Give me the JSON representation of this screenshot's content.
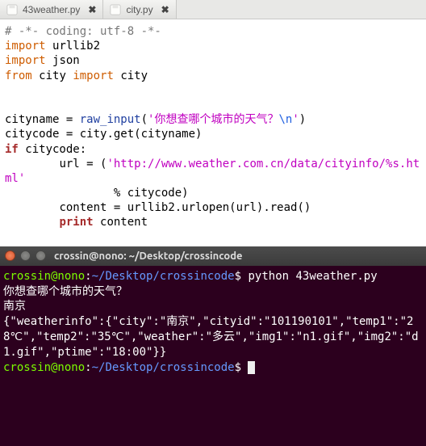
{
  "editor": {
    "tabs": [
      {
        "filename": "43weather.py",
        "close_glyph": "✖"
      },
      {
        "filename": "city.py",
        "close_glyph": "✖"
      }
    ],
    "code": {
      "l1": "# -*- coding: utf-8 -*-",
      "l2_kw": "import",
      "l2_mod": "urllib2",
      "l3_kw": "import",
      "l3_mod": "json",
      "l4_kw": "from",
      "l4_mod": "city",
      "l4_kw2": "import",
      "l4_name": "city",
      "l6_a": "cityname ",
      "l6_eq": "=",
      "l6_fn": " raw_input",
      "l6_paren_o": "(",
      "l6_str_o": "'",
      "l6_str_body": "你想查哪个城市的天气？",
      "l6_esc": "\\n",
      "l6_str_c": "'",
      "l6_paren_c": ")",
      "l7_a": "citycode ",
      "l7_eq": "=",
      "l7_rest": " city.get(cityname)",
      "l8_kw": "if",
      "l8_rest": " citycode:",
      "l9_a": "        url ",
      "l9_eq": "=",
      "l9_sp": " (",
      "l9_str": "'http://www.weather.com.cn/data/cityinfo/%s.html'",
      "l10": "                % citycode)",
      "l11_a": "        content ",
      "l11_eq": "=",
      "l11_rest": " urllib2.urlopen(url).read()",
      "l12_indent": "        ",
      "l12_kw": "print",
      "l12_rest": " content"
    }
  },
  "terminal": {
    "title": "crossin@nono: ~/Desktop/crossincode",
    "prompt_user": "crossin@nono",
    "prompt_sep": ":",
    "prompt_path": "~/Desktop/crossincode",
    "prompt_dollar": "$",
    "lines": {
      "cmd1": " python 43weather.py",
      "q": "你想查哪个城市的天气？",
      "ans": "南京",
      "json": "{\"weatherinfo\":{\"city\":\"南京\",\"cityid\":\"101190101\",\"temp1\":\"28℃\",\"temp2\":\"35℃\",\"weather\":\"多云\",\"img1\":\"n1.gif\",\"img2\":\"d1.gif\",\"ptime\":\"18:00\"}}"
    }
  }
}
